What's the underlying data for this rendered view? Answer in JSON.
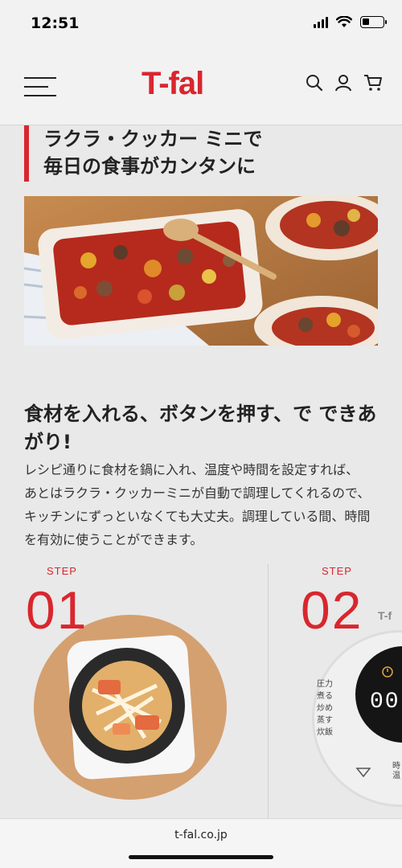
{
  "status": {
    "time": "12:51"
  },
  "header": {
    "logo": "T-fal"
  },
  "heading": {
    "line1": "ラクラ・クッカー ミニで",
    "line2": "毎日の食事がカンタンに"
  },
  "section": {
    "subtitle_line1": "食材を入れる、ボタンを押す、で できあ",
    "subtitle_line2": "がり!",
    "desc_line1": "レシピ通りに食材を鍋に入れ、温度や時間を設定すれば、",
    "desc_line2": "あとはラクラ・クッカーミニが自動で調理してくれるので、",
    "desc_line3": "キッチンにずっといなくても大丈夫。調理している間、時間",
    "desc_line4": "を有効に使うことができます。"
  },
  "steps": [
    {
      "label": "STEP",
      "number": "01"
    },
    {
      "label": "STEP",
      "number": "02"
    }
  ],
  "device": {
    "brand": "T-f",
    "menu": [
      "圧力",
      "煮る",
      "炒め",
      "蒸す",
      "炊飯"
    ],
    "display": "00",
    "time_label_1": "時",
    "time_label_2": "温"
  },
  "browser": {
    "url": "t-fal.co.jp"
  },
  "colors": {
    "brand_red": "#d9262e",
    "background": "#e9e9e9"
  }
}
